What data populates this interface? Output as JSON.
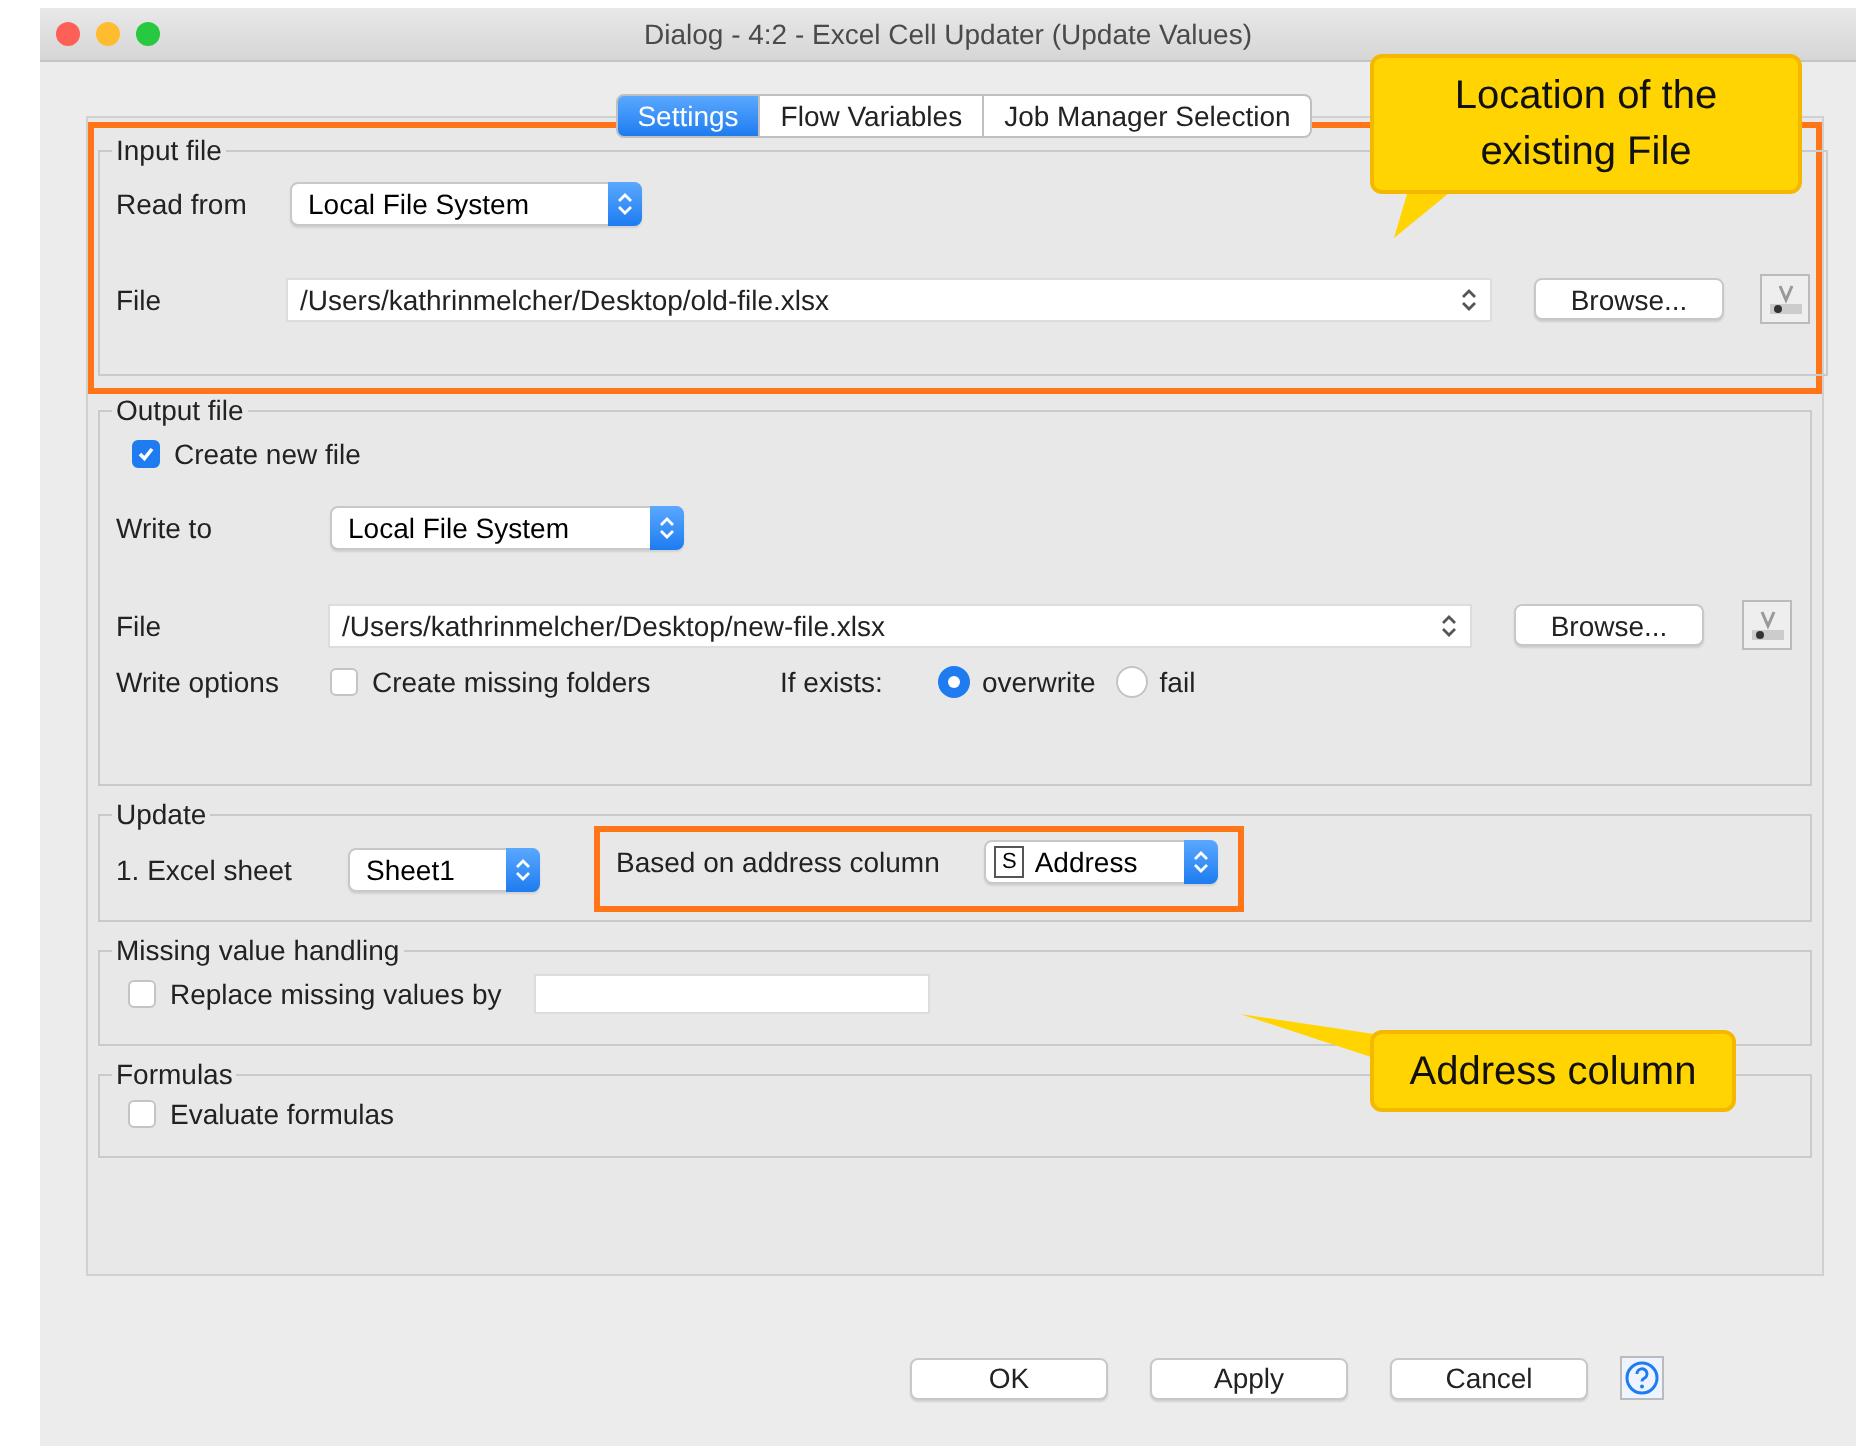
{
  "window": {
    "title": "Dialog - 4:2 - Excel Cell Updater (Update Values)"
  },
  "tabs": [
    {
      "label": "Settings",
      "selected": true
    },
    {
      "label": "Flow Variables",
      "selected": false
    },
    {
      "label": "Job Manager Selection",
      "selected": false
    }
  ],
  "input_file": {
    "legend": "Input file",
    "read_from_label": "Read from",
    "read_from_value": "Local File System",
    "file_label": "File",
    "file_value": "/Users/kathrinmelcher/Desktop/old-file.xlsx",
    "browse": "Browse...",
    "highlighted": true
  },
  "output_file": {
    "legend": "Output file",
    "create_new_file": {
      "label": "Create new file",
      "checked": true
    },
    "write_to_label": "Write to",
    "write_to_value": "Local File System",
    "file_label": "File",
    "file_value": "/Users/kathrinmelcher/Desktop/new-file.xlsx",
    "browse": "Browse...",
    "write_options_label": "Write options",
    "create_missing_folders": {
      "label": "Create missing folders",
      "checked": false
    },
    "if_exists_label": "If exists:",
    "if_exists_options": [
      {
        "label": "overwrite",
        "selected": true
      },
      {
        "label": "fail",
        "selected": false
      }
    ]
  },
  "update": {
    "legend": "Update",
    "sheet_label": "1. Excel sheet",
    "sheet_value": "Sheet1",
    "address_label": "Based on address column",
    "address_type": "S",
    "address_value": "Address",
    "highlighted": true
  },
  "missing_value_handling": {
    "legend": "Missing value handling",
    "replace": {
      "label": "Replace missing values by",
      "checked": false
    }
  },
  "formulas": {
    "legend": "Formulas",
    "evaluate": {
      "label": "Evaluate formulas",
      "checked": false
    }
  },
  "buttons": [
    "OK",
    "Apply",
    "Cancel"
  ],
  "callouts": [
    {
      "text": "Location of the existing File"
    },
    {
      "text": "Address column"
    }
  ]
}
